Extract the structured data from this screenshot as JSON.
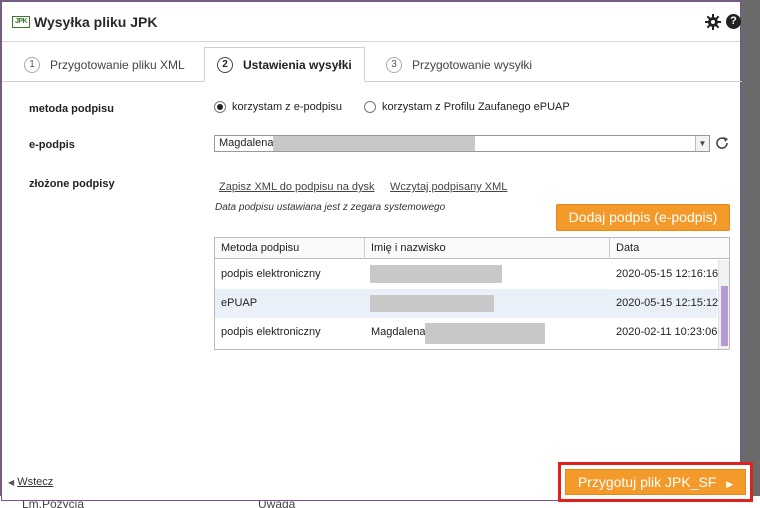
{
  "window": {
    "title": "Wysyłka pliku JPK",
    "logo_text": "JPK"
  },
  "tabs": [
    {
      "num": "1",
      "label": "Przygotowanie pliku XML"
    },
    {
      "num": "2",
      "label": "Ustawienia wysyłki"
    },
    {
      "num": "3",
      "label": "Przygotowanie wysyłki"
    }
  ],
  "form": {
    "method_label": "metoda podpisu",
    "radio_epodpis": "korzystam z e-podpisu",
    "radio_epuap": "korzystam z Profilu Zaufanego ePUAP",
    "epodpis_label": "e-podpis",
    "epodpis_value": "Magdalena",
    "signatures_label": "złożone podpisy",
    "save_xml_link": "Zapisz XML do podpisu na dysk",
    "load_signed_link": "Wczytaj podpisany XML",
    "note": "Data podpisu ustawiana jest z zegara systemowego",
    "add_signature_button": "Dodaj podpis (e-podpis)"
  },
  "table": {
    "headers": [
      "Metoda podpisu",
      "Imię i nazwisko",
      "Data"
    ],
    "rows": [
      {
        "method": "podpis elektroniczny",
        "name": "",
        "date": "2020-05-15 12:16:16"
      },
      {
        "method": "ePUAP",
        "name": "",
        "date": "2020-05-15 12:15:12"
      },
      {
        "method": "podpis elektroniczny",
        "name": "Magdalena",
        "date": "2020-02-11 10:23:06"
      }
    ]
  },
  "footer": {
    "back_link": "Wstecz",
    "next_button": "Przygotuj plik JPK_SF"
  },
  "background_strip": {
    "left_text": "Lm.Pozycja",
    "right_text": "Uwaga"
  },
  "colors": {
    "accent": "#f39a2b",
    "highlight_border": "#e0221e",
    "scroll_thumb": "#b59ad3"
  }
}
